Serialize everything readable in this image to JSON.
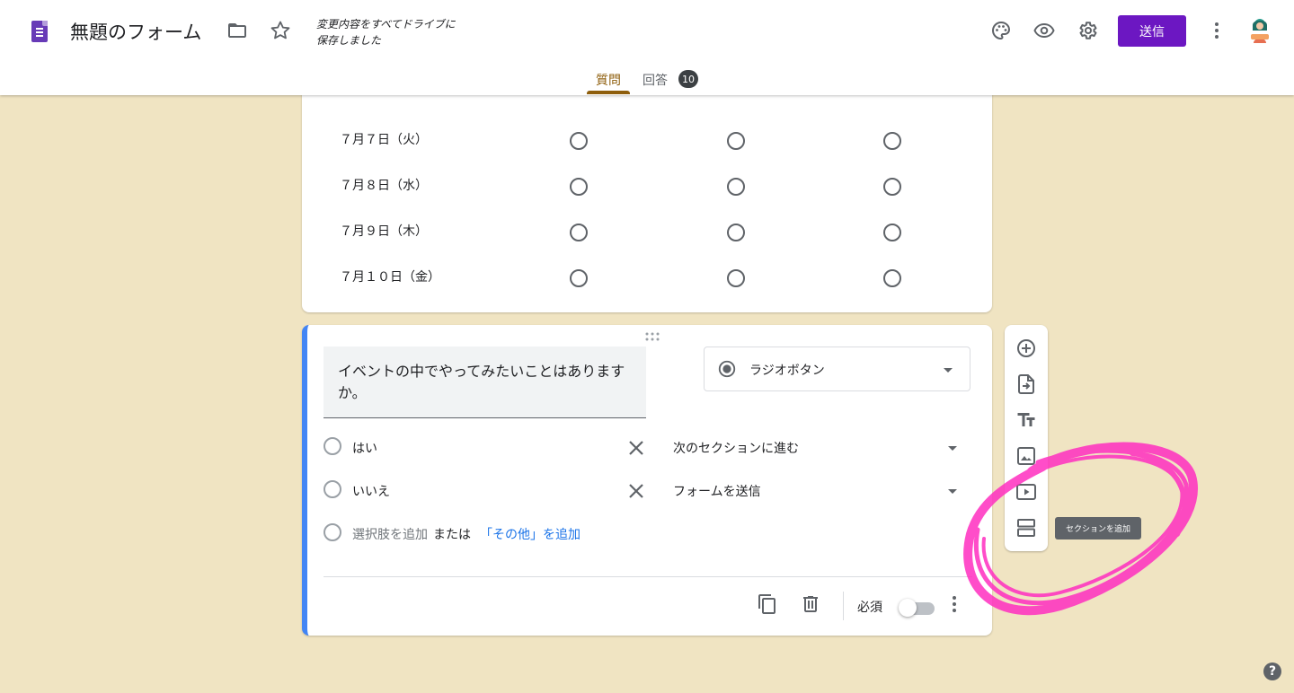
{
  "header": {
    "title": "無題のフォーム",
    "save_status_line1": "変更内容をすべてドライブに",
    "save_status_line2": "保存しました",
    "send_label": "送信",
    "icons": [
      "folder-icon",
      "star-icon",
      "palette-icon",
      "eye-icon",
      "gear-icon",
      "more-vert-icon"
    ]
  },
  "tabs": {
    "questions": "質問",
    "responses": "回答",
    "responses_count": "10"
  },
  "grid": {
    "rows": [
      "７月７日（火）",
      "７月８日（水）",
      "７月９日（木）",
      "７月１０日（金）"
    ]
  },
  "question": {
    "title": "イベントの中でやってみたいことはありますか。",
    "type": "ラジオボタン",
    "options": [
      {
        "label": "はい",
        "goto": "次のセクションに進む"
      },
      {
        "label": "いいえ",
        "goto": "フォームを送信"
      }
    ],
    "add_option": "選択肢を追加",
    "or": "または",
    "add_other": "「その他」を追加",
    "required_label": "必須"
  },
  "toolbar": {
    "tooltip": "セクションを追加"
  },
  "help": "?",
  "colors": {
    "accent": "#6c17c2",
    "tab_active": "#8e5e0c",
    "background": "#f0e4c2",
    "card_accent": "#4285f4",
    "annotation": "#ff2fc0"
  }
}
